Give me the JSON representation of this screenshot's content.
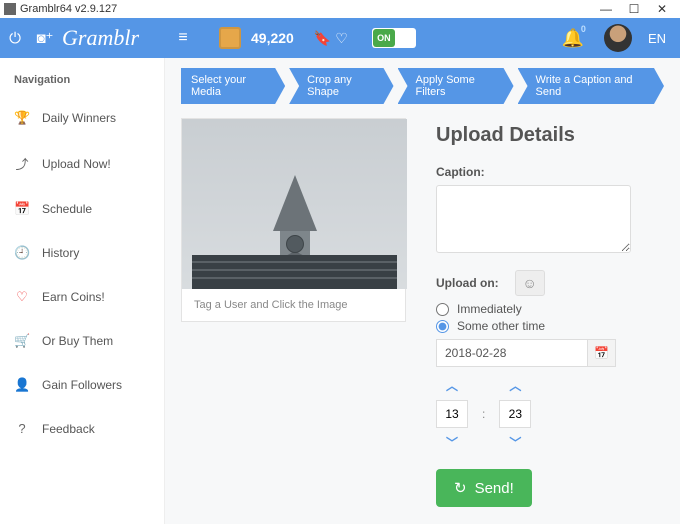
{
  "window": {
    "title": "Gramblr64 v2.9.127"
  },
  "topbar": {
    "brand": "Gramblr",
    "coins": "49,220",
    "toggle_on": "ON",
    "bell_badge": "0",
    "lang": "EN"
  },
  "sidebar": {
    "heading": "Navigation",
    "items": [
      {
        "icon": "🏆",
        "label": "Daily Winners"
      },
      {
        "icon": "⤴",
        "label": "Upload Now!"
      },
      {
        "icon": "📅",
        "label": "Schedule"
      },
      {
        "icon": "🕘",
        "label": "History"
      },
      {
        "icon": "♡",
        "label": "Earn Coins!"
      },
      {
        "icon": "🛒",
        "label": "Or Buy Them"
      },
      {
        "icon": "👤",
        "label": "Gain Followers"
      },
      {
        "icon": "?",
        "label": "Feedback"
      }
    ]
  },
  "breadcrumbs": [
    "Select your Media",
    "Crop any Shape",
    "Apply Some Filters",
    "Write a Caption and Send"
  ],
  "preview": {
    "tag_hint": "Tag a User and Click the Image"
  },
  "details": {
    "heading": "Upload Details",
    "caption_label": "Caption:",
    "caption_value": "",
    "upload_on_label": "Upload on:",
    "radio_immediately": "Immediately",
    "radio_other": "Some other time",
    "date": "2018-02-28",
    "hour": "13",
    "minute": "23",
    "colon": ":",
    "send": "Send!"
  }
}
